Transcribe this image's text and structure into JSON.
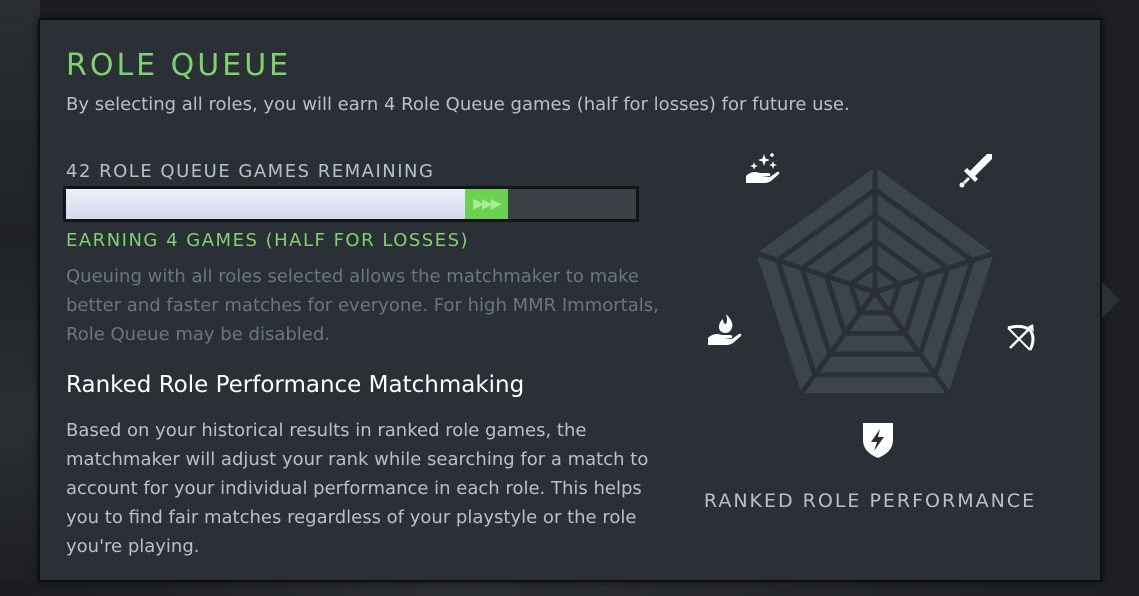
{
  "header": {
    "title": "ROLE QUEUE",
    "subtitle": "By selecting all roles, you will earn 4 Role Queue games (half for losses) for future use."
  },
  "role_queue": {
    "games_remaining_label": "42 ROLE QUEUE GAMES REMAINING",
    "progress": {
      "current_fraction": 0.7,
      "earning_fraction": 0.075,
      "earning_glyph": "▶▶▶"
    },
    "earning_label": "EARNING 4 GAMES (HALF FOR LOSSES)",
    "description": "Queuing with all roles selected allows the matchmaker to make better and faster matches for everyone. For high MMR Immortals, Role Queue may be disabled."
  },
  "ranked_performance": {
    "title": "Ranked Role Performance Matchmaking",
    "description": "Based on your historical results in ranked role games, the matchmaker will adjust your rank while searching for a match to account for your individual performance in each role. This helps you to find fair matches regardless of your playstyle or the role you're playing."
  },
  "radar": {
    "label": "RANKED ROLE PERFORMANCE",
    "roles": [
      {
        "icon": "sword-icon",
        "position": "top-right"
      },
      {
        "icon": "bow-icon",
        "position": "right"
      },
      {
        "icon": "shield-lightning-icon",
        "position": "bottom"
      },
      {
        "icon": "hand-flame-icon",
        "position": "left"
      },
      {
        "icon": "hand-sparkles-icon",
        "position": "top-left"
      }
    ]
  },
  "colors": {
    "accent_green": "#7fd36e",
    "panel_bg": "#2b3036",
    "radar_fill": "#3d444b",
    "progress_fill": "#e2e5f5"
  }
}
